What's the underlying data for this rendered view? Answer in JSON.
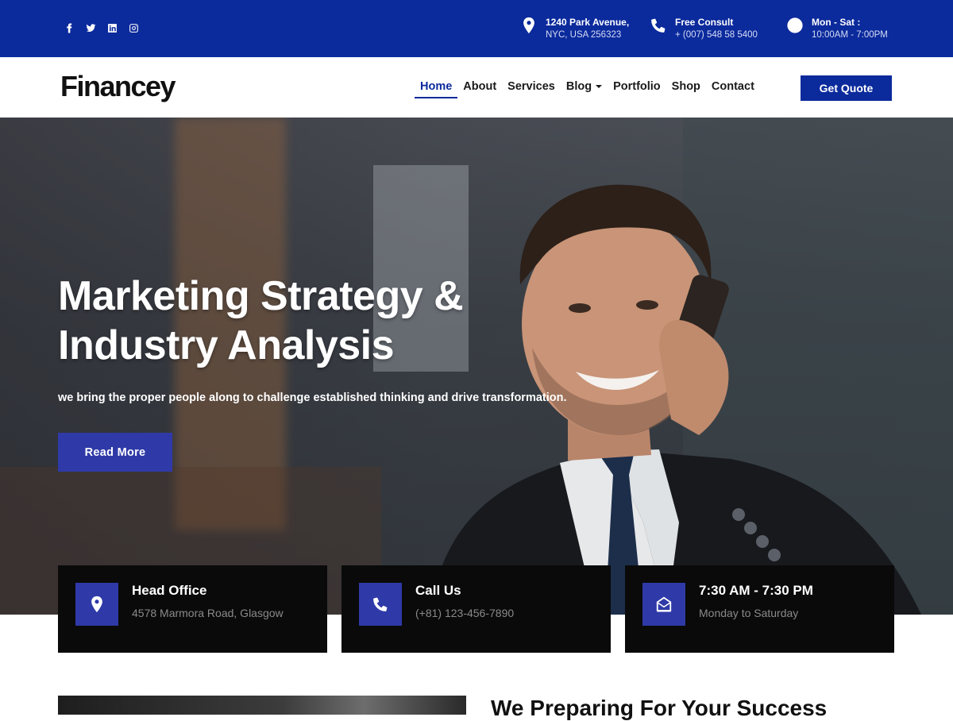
{
  "topbar": {
    "social": [
      {
        "icon": "facebook-icon"
      },
      {
        "icon": "twitter-icon"
      },
      {
        "icon": "linkedin-icon"
      },
      {
        "icon": "instagram-icon"
      }
    ],
    "address": {
      "title": "1240 Park Avenue,",
      "sub": "NYC, USA 256323",
      "icon": "map-pin-icon"
    },
    "consult": {
      "title": "Free Consult",
      "sub": "+ (007) 548 58 5400",
      "icon": "phone-icon"
    },
    "hours": {
      "title": "Mon - Sat :",
      "sub": "10:00AM - 7:00PM",
      "icon": "clock-icon"
    }
  },
  "header": {
    "logo": "Financey",
    "nav": [
      {
        "label": "Home",
        "active": true
      },
      {
        "label": "About"
      },
      {
        "label": "Services"
      },
      {
        "label": "Blog",
        "dropdown": true
      },
      {
        "label": "Portfolio"
      },
      {
        "label": "Shop"
      },
      {
        "label": "Contact"
      }
    ],
    "cta": "Get Quote"
  },
  "hero": {
    "title": "Marketing Strategy & Industry Analysis",
    "subtitle": "we bring the proper people along to challenge established thinking and drive transformation.",
    "button": "Read More"
  },
  "cards": [
    {
      "icon": "map-pin-icon",
      "title": "Head Office",
      "sub": "4578 Marmora Road, Glasgow"
    },
    {
      "icon": "phone-icon",
      "title": "Call Us",
      "sub": "(+81) 123-456-7890"
    },
    {
      "icon": "envelope-open-icon",
      "title": "7:30 AM - 7:30 PM",
      "sub": "Monday to Saturday"
    }
  ],
  "about": {
    "heading": "We Preparing For Your Success"
  },
  "colors": {
    "primary": "#0b2a9c",
    "accent": "#2f3aa8",
    "card_bg": "#0a0a0a"
  }
}
